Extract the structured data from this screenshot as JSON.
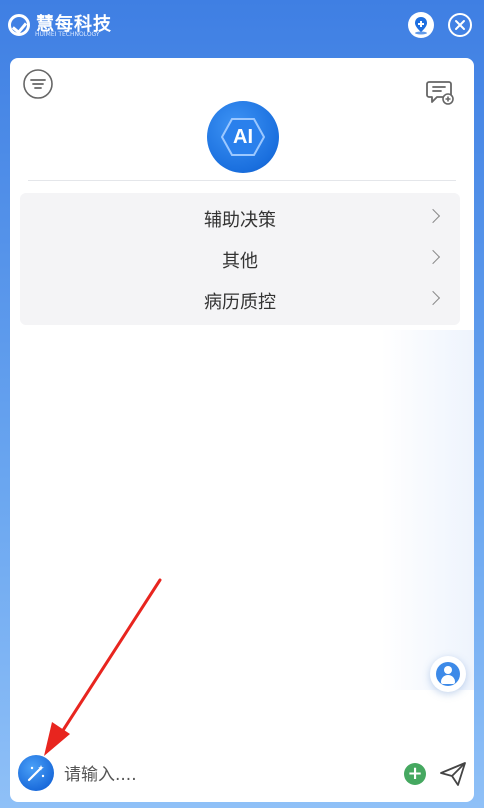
{
  "titlebar": {
    "logo_text": "慧每科技",
    "logo_subtext": "HUIMEI TECHNOLOGY"
  },
  "ai_avatar": {
    "label": "AI"
  },
  "menu": {
    "items": [
      {
        "label": "辅助决策"
      },
      {
        "label": "其他"
      },
      {
        "label": "病历质控"
      }
    ]
  },
  "input": {
    "placeholder": "请输入...."
  },
  "colors": {
    "title_bar": "#3f7fe3",
    "accent": "#1a6fde",
    "attach_green": "#45a860",
    "annotation_arrow": "#e8251f"
  },
  "icons": {
    "logo": "check-circle-logo-icon",
    "pin": "pin-location-icon",
    "close": "close-icon",
    "filter": "filter-lines-icon",
    "new_chat": "new-chat-icon",
    "support": "customer-support-icon",
    "magic": "magic-wand-icon",
    "attach": "plus-circle-icon",
    "send": "send-icon"
  }
}
